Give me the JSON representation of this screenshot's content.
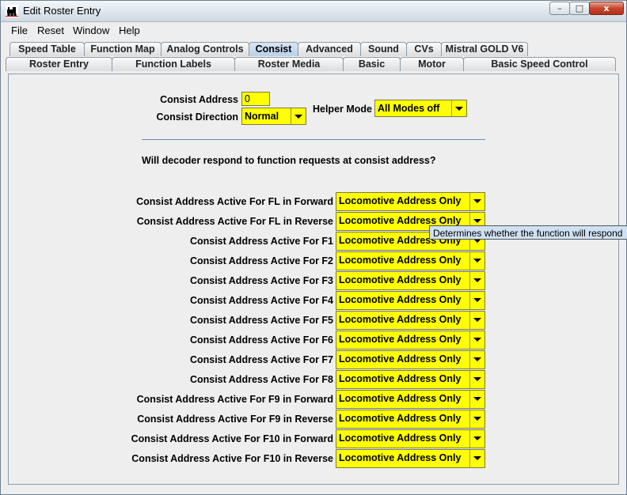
{
  "window": {
    "title": "Edit Roster Entry",
    "buttons": {
      "minimize": "–",
      "maximize": "□",
      "close": "x"
    }
  },
  "menu": [
    "File",
    "Reset",
    "Window",
    "Help"
  ],
  "tabs_row1": [
    "Speed Table",
    "Function Map",
    "Analog Controls",
    "Consist",
    "Advanced",
    "Sound",
    "CVs",
    "Mistral GOLD V6"
  ],
  "tabs_row2": [
    "Roster Entry",
    "Function Labels",
    "Roster Media",
    "Basic",
    "Motor",
    "Basic Speed Control"
  ],
  "selected_tab": "Consist",
  "consist": {
    "address_label": "Consist Address",
    "address_value": "0",
    "direction_label": "Consist Direction",
    "direction_value": "Normal",
    "helper_label": "Helper Mode",
    "helper_value": "All Modes off",
    "question": "Will decoder respond to function requests at consist address?"
  },
  "function_rows": [
    {
      "label": "Consist Address Active For FL in Forward",
      "value": "Locomotive Address Only"
    },
    {
      "label": "Consist Address Active For FL in Reverse",
      "value": "Locomotive Address Only"
    },
    {
      "label": "Consist Address Active For F1",
      "value": "Locomotive Address Only"
    },
    {
      "label": "Consist Address Active For F2",
      "value": "Locomotive Address Only"
    },
    {
      "label": "Consist Address Active For F3",
      "value": "Locomotive Address Only"
    },
    {
      "label": "Consist Address Active For F4",
      "value": "Locomotive Address Only"
    },
    {
      "label": "Consist Address Active For F5",
      "value": "Locomotive Address Only"
    },
    {
      "label": "Consist Address Active For F6",
      "value": "Locomotive Address Only"
    },
    {
      "label": "Consist Address Active For F7",
      "value": "Locomotive Address Only"
    },
    {
      "label": "Consist Address Active For F8",
      "value": "Locomotive Address Only"
    },
    {
      "label": "Consist Address Active For F9 in Forward",
      "value": "Locomotive Address Only"
    },
    {
      "label": "Consist Address Active For F9 in Reverse",
      "value": "Locomotive Address Only"
    },
    {
      "label": "Consist Address Active For F10 in Forward",
      "value": "Locomotive Address Only"
    },
    {
      "label": "Consist Address Active For F10 in Reverse",
      "value": "Locomotive Address Only"
    }
  ],
  "tooltip": "Determines whether the function will respond",
  "colors": {
    "field_bg": "#ffff00",
    "selected_tab": "#b8d0e8",
    "separator": "#6a8db5"
  }
}
